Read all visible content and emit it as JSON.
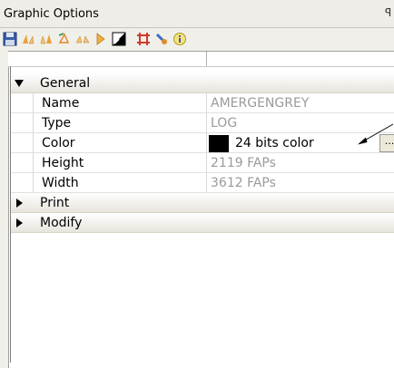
{
  "panel": {
    "title": "Graphic Options",
    "pin_glyph": "ꟼ"
  },
  "toolbar": {
    "icons": [
      "save-icon",
      "mirror-a-icon",
      "mirror-b-icon",
      "rotate-icon",
      "flip-icon",
      "arrow-right-icon",
      "crop-square-icon",
      "frame-icon",
      "paint-icon",
      "info-icon"
    ]
  },
  "grid": {
    "categories": [
      {
        "label": "General",
        "expanded": true
      },
      {
        "label": "Print",
        "expanded": false
      },
      {
        "label": "Modify",
        "expanded": false
      }
    ],
    "rows": [
      {
        "name": "Name",
        "value": "AMERGENGREY"
      },
      {
        "name": "Type",
        "value": "LOG"
      },
      {
        "name": "Color",
        "value": "24 bits color",
        "swatch": "#000000",
        "button": "..."
      },
      {
        "name": "Height",
        "value": "2119 FAPs"
      },
      {
        "name": "Width",
        "value": "3612 FAPs"
      }
    ]
  }
}
